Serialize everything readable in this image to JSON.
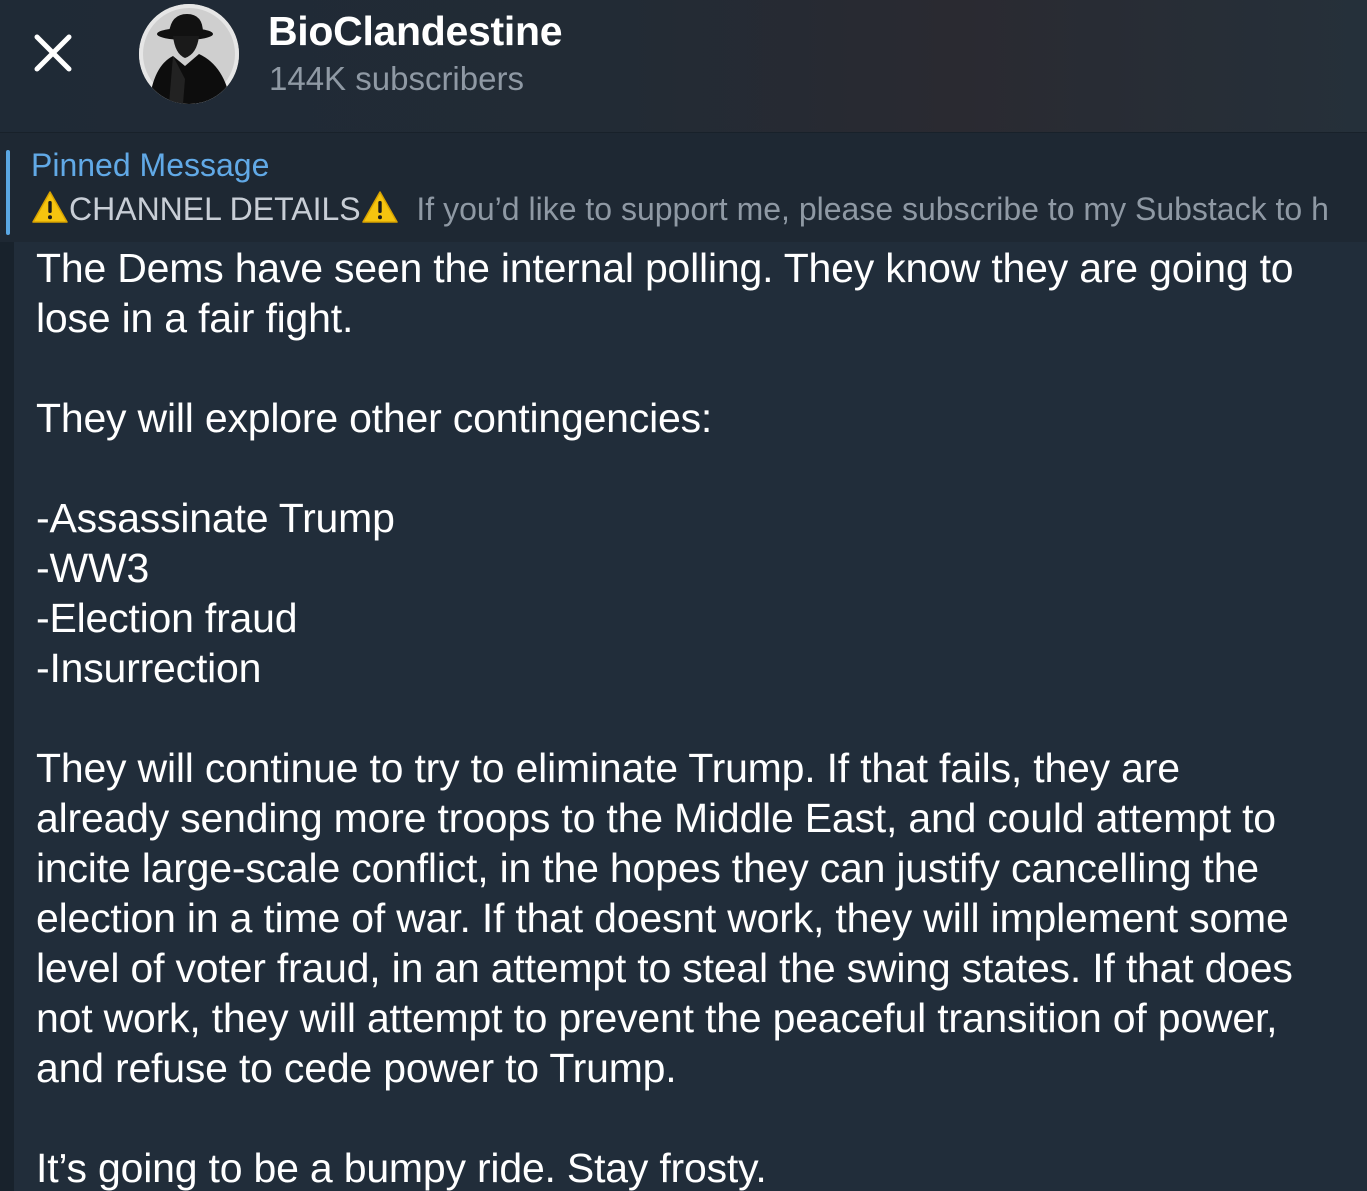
{
  "header": {
    "channel_name": "BioClandestine",
    "subscribers": "144K subscribers",
    "close_icon": "close-icon",
    "avatar": "channel-avatar-spy-silhouette"
  },
  "pinned": {
    "label": "Pinned Message",
    "title_highlight": "CHANNEL DETAILS",
    "preview_text": "If you’d like to support me, please subscribe to my Substack to h",
    "icon": "warning-icon",
    "accent_color": "#61a9e6"
  },
  "message": {
    "lines": [
      "The Dems have seen the internal polling. They know they are going to",
      "lose in a fair fight.",
      "",
      "They will explore other contingencies:",
      "",
      "-Assassinate Trump",
      "-WW3",
      "-Election fraud",
      "-Insurrection",
      "",
      "They will continue to try to eliminate Trump. If that fails, they are",
      "already sending more troops to the Middle East, and could attempt to",
      "incite large-scale conflict, in the hopes they can justify cancelling the",
      "election in a time of war. If that doesnt work, they will implement some",
      "level of voter fraud, in an attempt to steal the swing states. If that does",
      "not work, they will attempt to prevent the peaceful transition of power,",
      "and refuse to cede power to Trump.",
      "",
      "It’s going to be a bumpy ride. Stay frosty."
    ]
  },
  "colors": {
    "header_bg": "#222b35",
    "bubble_bg": "#212d3a",
    "text": "#ffffff",
    "muted": "#8f99a4"
  }
}
